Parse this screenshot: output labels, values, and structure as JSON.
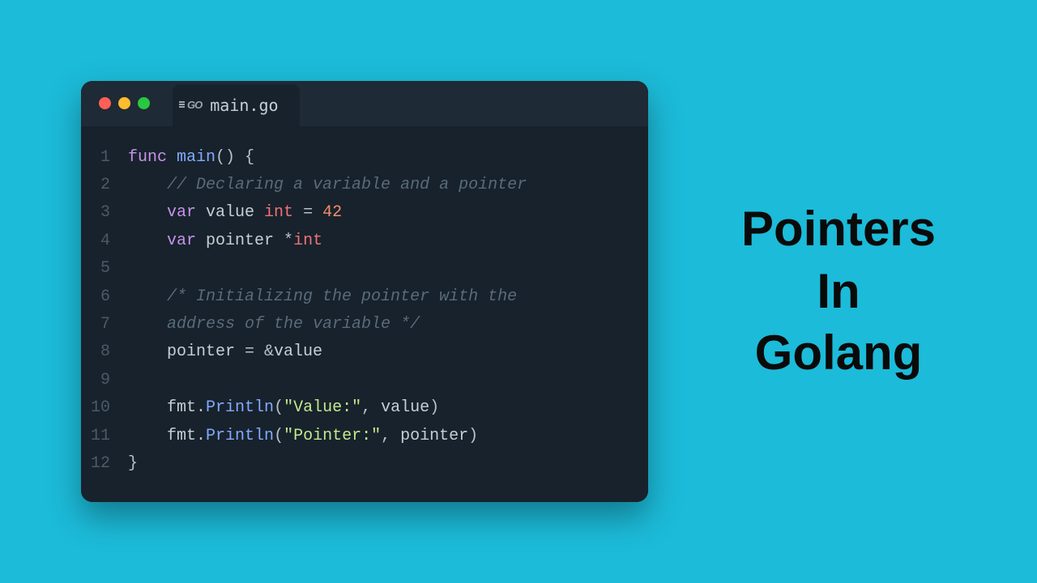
{
  "heading": {
    "line1": "Pointers",
    "line2": "In",
    "line3": "Golang"
  },
  "window": {
    "traffic_colors": {
      "close": "#ff5f57",
      "min": "#febc2e",
      "max": "#28c840"
    },
    "tab": {
      "logo_text": "GO",
      "filename": "main.go"
    }
  },
  "code": {
    "lines": [
      {
        "n": "1",
        "tokens": [
          [
            "kw",
            "func "
          ],
          [
            "fn",
            "main"
          ],
          [
            "pn",
            "() {"
          ]
        ]
      },
      {
        "n": "2",
        "tokens": [
          [
            "id",
            "    "
          ],
          [
            "cm",
            "// Declaring a variable and a pointer"
          ]
        ]
      },
      {
        "n": "3",
        "tokens": [
          [
            "id",
            "    "
          ],
          [
            "kw",
            "var "
          ],
          [
            "id",
            "value "
          ],
          [
            "tp",
            "int"
          ],
          [
            "pn",
            " = "
          ],
          [
            "nm",
            "42"
          ]
        ]
      },
      {
        "n": "4",
        "tokens": [
          [
            "id",
            "    "
          ],
          [
            "kw",
            "var "
          ],
          [
            "id",
            "pointer "
          ],
          [
            "pn",
            "*"
          ],
          [
            "tp",
            "int"
          ]
        ]
      },
      {
        "n": "5",
        "tokens": []
      },
      {
        "n": "6",
        "tokens": [
          [
            "id",
            "    "
          ],
          [
            "cm",
            "/* Initializing the pointer with the"
          ]
        ]
      },
      {
        "n": "7",
        "tokens": [
          [
            "id",
            "    "
          ],
          [
            "cm",
            "address of the variable */"
          ]
        ]
      },
      {
        "n": "8",
        "tokens": [
          [
            "id",
            "    "
          ],
          [
            "id",
            "pointer "
          ],
          [
            "pn",
            "= &"
          ],
          [
            "id",
            "value"
          ]
        ]
      },
      {
        "n": "9",
        "tokens": []
      },
      {
        "n": "10",
        "tokens": [
          [
            "id",
            "    "
          ],
          [
            "id",
            "fmt"
          ],
          [
            "pn",
            "."
          ],
          [
            "fn",
            "Println"
          ],
          [
            "pn",
            "("
          ],
          [
            "st",
            "\"Value:\""
          ],
          [
            "pn",
            ", "
          ],
          [
            "id",
            "value"
          ],
          [
            "pn",
            ")"
          ]
        ]
      },
      {
        "n": "11",
        "tokens": [
          [
            "id",
            "    "
          ],
          [
            "id",
            "fmt"
          ],
          [
            "pn",
            "."
          ],
          [
            "fn",
            "Println"
          ],
          [
            "pn",
            "("
          ],
          [
            "st",
            "\"Pointer:\""
          ],
          [
            "pn",
            ", "
          ],
          [
            "id",
            "pointer"
          ],
          [
            "pn",
            ")"
          ]
        ]
      },
      {
        "n": "12",
        "tokens": [
          [
            "pn",
            "}"
          ]
        ]
      }
    ]
  }
}
